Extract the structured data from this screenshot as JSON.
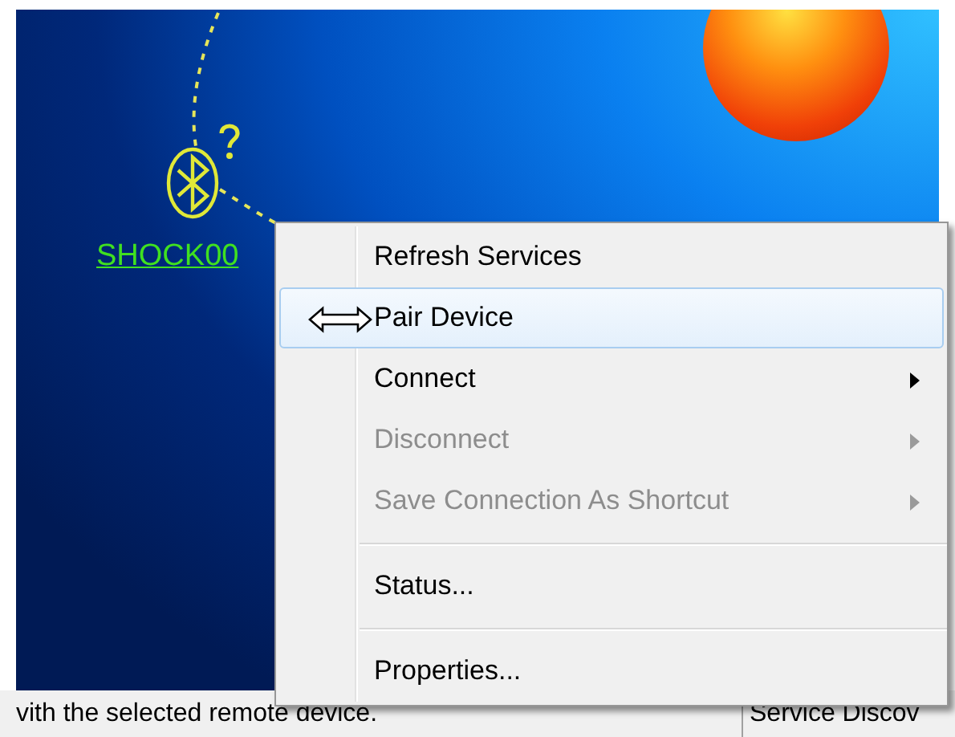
{
  "device": {
    "name": "SHOCK00"
  },
  "context_menu": {
    "items": [
      {
        "kind": "item",
        "label": "Refresh Services",
        "selected": false,
        "disabled": false,
        "submenu": false
      },
      {
        "kind": "item",
        "label": "Pair Device",
        "selected": true,
        "disabled": false,
        "submenu": false
      },
      {
        "kind": "item",
        "label": "Connect",
        "selected": false,
        "disabled": false,
        "submenu": true
      },
      {
        "kind": "item",
        "label": "Disconnect",
        "selected": false,
        "disabled": true,
        "submenu": true
      },
      {
        "kind": "item",
        "label": "Save Connection As Shortcut",
        "selected": false,
        "disabled": true,
        "submenu": true
      },
      {
        "kind": "separator"
      },
      {
        "kind": "item",
        "label": "Status...",
        "selected": false,
        "disabled": false,
        "submenu": false
      },
      {
        "kind": "separator"
      },
      {
        "kind": "item",
        "label": "Properties...",
        "selected": false,
        "disabled": false,
        "submenu": false
      }
    ]
  },
  "status_bar": {
    "message": "vith the selected remote device.",
    "panel_2": "Service Discov"
  }
}
